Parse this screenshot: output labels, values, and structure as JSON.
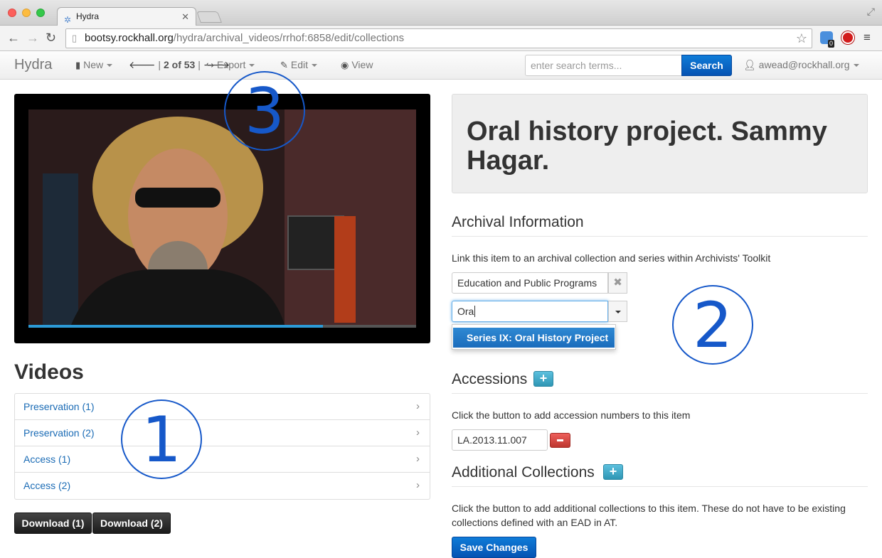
{
  "browser": {
    "tab_title": "Hydra",
    "url_host": "bootsy.rockhall.org",
    "url_path": "/hydra/archival_videos/rrhof:6858/edit/collections",
    "extension_badge": "0"
  },
  "navbar": {
    "brand": "Hydra",
    "new_label": "New",
    "pager_current": "2",
    "pager_of": "of",
    "pager_total": "53",
    "export_label": "Export",
    "edit_label": "Edit",
    "view_label": "View",
    "search_placeholder": "enter search terms...",
    "search_button": "Search",
    "user": "awead@rockhall.org"
  },
  "video": {
    "progress_fraction": 0.76
  },
  "videos": {
    "title": "Videos",
    "items": [
      {
        "label": "Preservation (1)"
      },
      {
        "label": "Preservation (2)"
      },
      {
        "label": "Access (1)"
      },
      {
        "label": "Access (2)"
      }
    ],
    "download_buttons": [
      "Download (1)",
      "Download (2)"
    ]
  },
  "record": {
    "title": "Oral history project. Sammy Hagar."
  },
  "archival": {
    "heading": "Archival Information",
    "help": "Link this item to an archival collection and series within Archivists' Toolkit",
    "collection_value": "Education and Public Programs",
    "series_input_value": "Ora",
    "suggestion_prefix": "Series IX: ",
    "suggestion_match": "Ora",
    "suggestion_suffix": "l History Project"
  },
  "accessions": {
    "heading": "Accessions",
    "help": "Click the button to add accession numbers to this item",
    "value": "LA.2013.11.007"
  },
  "additional": {
    "heading": "Additional Collections",
    "help": "Click the button to add additional collections to this item. These do not have to be existing collections defined with an EAD in AT."
  },
  "save_button": "Save Changes",
  "annotations": [
    "1",
    "2",
    "3"
  ],
  "colors": {
    "primary": "#0553b3",
    "link": "#1a6bb5",
    "annotation": "#1658c9",
    "info_button": "#2f96b4",
    "danger_button": "#bd362f"
  }
}
